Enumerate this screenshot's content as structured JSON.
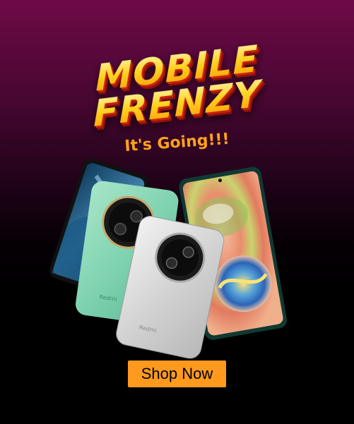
{
  "headline": {
    "line1": "MOBILE",
    "line2": "FRENZY"
  },
  "tagline": "It's Going!!!",
  "cta": {
    "label": "Shop Now"
  },
  "phones": [
    {
      "name": "tablet-phone-blue-wallpaper",
      "brand": ""
    },
    {
      "name": "green-redmi-phone",
      "brand": "Redmi"
    },
    {
      "name": "silver-redmi-phone",
      "brand": "Redmi"
    },
    {
      "name": "galaxy-phone-swirl-wallpaper",
      "brand": ""
    }
  ],
  "colors": {
    "background_top": "#6e0a47",
    "background_bottom": "#000000",
    "headline_yellow": "#ffd21f",
    "headline_shadow": "#c8220e",
    "tagline_orange": "#ffa21a",
    "button_orange": "#ff9a1f",
    "phone_green": "#7fd3b0",
    "phone_silver": "#d7d7d7"
  }
}
